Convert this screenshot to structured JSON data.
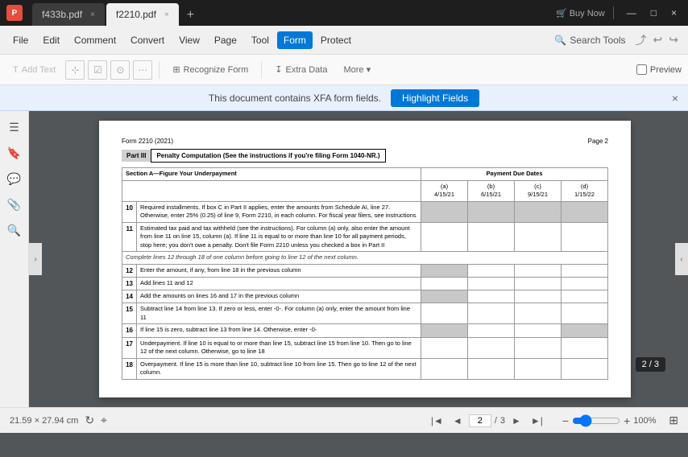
{
  "titleBar": {
    "appIcon": "P",
    "tabs": [
      {
        "id": "tab1",
        "label": "f433b.pdf",
        "active": false
      },
      {
        "id": "tab2",
        "label": "f2210.pdf",
        "active": true
      }
    ],
    "addTab": "+",
    "winButtons": [
      "—",
      "□",
      "×"
    ]
  },
  "menuBar": {
    "items": [
      {
        "id": "file",
        "label": "File"
      },
      {
        "id": "edit",
        "label": "Edit"
      },
      {
        "id": "comment",
        "label": "Comment"
      },
      {
        "id": "convert",
        "label": "Convert"
      },
      {
        "id": "view",
        "label": "View"
      },
      {
        "id": "page",
        "label": "Page"
      },
      {
        "id": "tool",
        "label": "Tool"
      },
      {
        "id": "form",
        "label": "Form",
        "active": true
      },
      {
        "id": "protect",
        "label": "Protect"
      }
    ],
    "searchTools": "Search Tools"
  },
  "toolbar": {
    "buttons": [
      {
        "id": "add-text",
        "label": "Add Text",
        "disabled": true
      },
      {
        "id": "recognize-form",
        "label": "Recognize Form",
        "disabled": false
      },
      {
        "id": "extra-data",
        "label": "Extra Data",
        "disabled": false
      },
      {
        "id": "more",
        "label": "More ▾",
        "disabled": false
      }
    ],
    "preview": "Preview"
  },
  "notification": {
    "text": "This document contains XFA form fields.",
    "button": "Highlight Fields",
    "close": "×"
  },
  "pdfPage": {
    "formNumber": "Form 2210 (2021)",
    "pageNum": "Page 2",
    "partLabel": "Part III",
    "partTitle": "Penalty Computation",
    "partNote": "(See the instructions if you're filing Form 1040-NR.)",
    "paymentHeader": "Payment Due Dates",
    "columns": [
      {
        "label": "(a)",
        "date": "4/15/21"
      },
      {
        "label": "(b)",
        "date": "6/15/21"
      },
      {
        "label": "(c)",
        "date": "9/15/21"
      },
      {
        "label": "(d)",
        "date": "1/15/22"
      }
    ],
    "sectionA": "Section A—Figure Your Underpayment",
    "rows": [
      {
        "num": "10",
        "desc": "Required installments. If box C in Part II applies, enter the amounts from Schedule AI, line 27. Otherwise, enter 25% (0.25) of line 9, Form 2210, in each column. For fiscal year filers, see instructions",
        "cells": [
          "gray",
          "gray",
          "gray",
          "gray"
        ]
      },
      {
        "num": "11",
        "desc": "Estimated tax paid and tax withheld (see the instructions). For column (a) only, also enter the amount from line 11 on line 15, column (a). If line 11 is equal to or more than line 10 for all payment periods, stop here; you don't owe a penalty. Don't file Form 2210 unless you checked a box in Part II",
        "cells": [
          "white",
          "white",
          "white",
          "white"
        ]
      },
      {
        "num": "",
        "desc": "Complete lines 12 through 18 of one column before going to line 12 of the next column.",
        "italic": true,
        "cells": null
      },
      {
        "num": "12",
        "desc": "Enter the amount, if any, from line 18 in the previous column",
        "cells": [
          "gray",
          "white",
          "white",
          "white"
        ]
      },
      {
        "num": "13",
        "desc": "Add lines 11 and 12",
        "cells": [
          "white",
          "white",
          "white",
          "white"
        ]
      },
      {
        "num": "14",
        "desc": "Add the amounts on lines 16 and 17 in the previous column",
        "cells": [
          "gray",
          "white",
          "white",
          "white"
        ]
      },
      {
        "num": "15",
        "desc": "Subtract line 14 from line 13. If zero or less, enter -0-. For column (a) only, enter the amount from line 11",
        "cells": [
          "white",
          "white",
          "white",
          "white"
        ]
      },
      {
        "num": "16",
        "desc": "If line 15 is zero, subtract line 13 from line 14. Otherwise, enter -0-",
        "cells": [
          "gray",
          "white",
          "white",
          "gray"
        ]
      },
      {
        "num": "17",
        "desc": "Underpayment. If line 10 is equal to or more than line 15, subtract line 15 from line 10. Then go to line 12 of the next column. Otherwise, go to line 18",
        "cells": [
          "white",
          "white",
          "white",
          "white"
        ]
      },
      {
        "num": "18",
        "desc": "Overpayment. If line 15 is more than line 10, subtract line 10 from line 15. Then go to line 12 of the next column.",
        "cells": [
          "white",
          "white",
          "white",
          "white"
        ]
      }
    ]
  },
  "bottomBar": {
    "dimensions": "21.59 × 27.94 cm",
    "icons": [
      "rotate",
      "cursor",
      "first",
      "prev"
    ],
    "pageInput": "2",
    "pageSeparator": "/",
    "pageTotal": "3",
    "nextBtn": "›",
    "lastBtn": "»",
    "zoomOut": "−",
    "zoomIn": "+",
    "zoomPercent": "100%",
    "fitBtn": "⊞"
  },
  "pageBadge": "2 / 3"
}
